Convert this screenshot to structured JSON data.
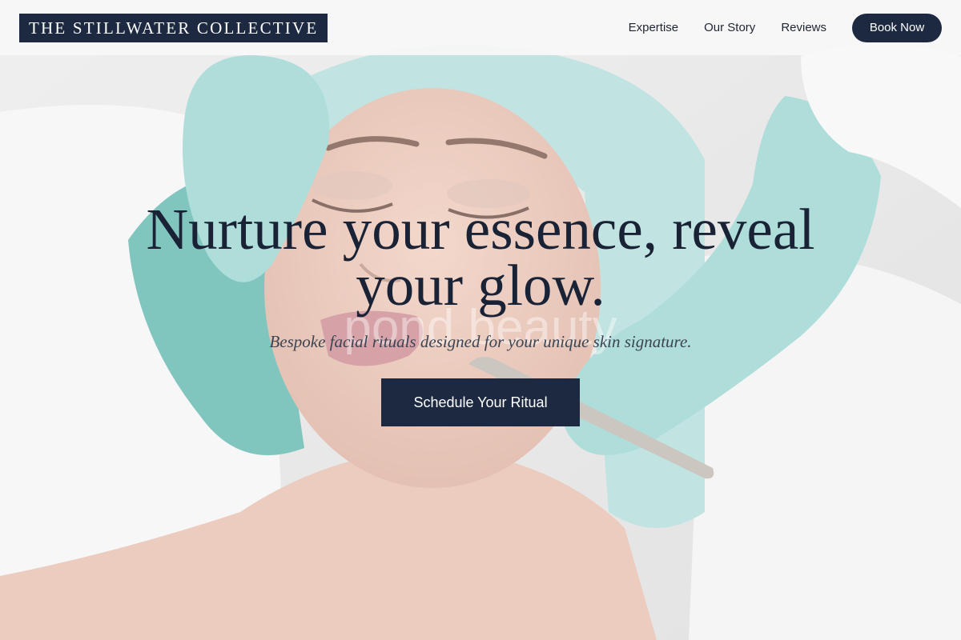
{
  "brand": {
    "name": "THE STILLWATER COLLECTIVE"
  },
  "nav": {
    "links": [
      {
        "label": "Expertise"
      },
      {
        "label": "Our Story"
      },
      {
        "label": "Reviews"
      }
    ],
    "cta_label": "Book Now"
  },
  "hero": {
    "title": "Nurture your essence, reveal your glow.",
    "subtitle": "Bespoke facial rituals designed for your unique skin signature.",
    "cta_label": "Schedule Your Ritual",
    "watermark": "pond.beauty"
  },
  "colors": {
    "brand_navy": "#1c2940",
    "heading": "#1a2235",
    "glove": "#8fd0cc",
    "towel": "#3fa79c"
  }
}
